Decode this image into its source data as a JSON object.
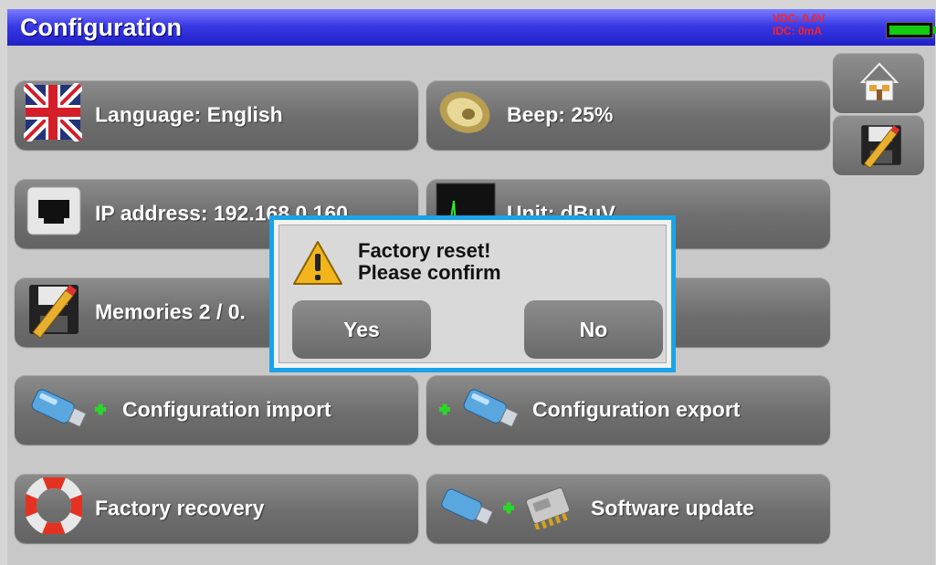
{
  "window": {
    "title": "Configuration"
  },
  "status": {
    "vdc": "VDC: 0.0V",
    "idc": "IDC: 0mA"
  },
  "menu": {
    "language": "Language: English",
    "beep": "Beep: 25%",
    "ip_address": "IP address: 192.168.0.160",
    "unit": "Unit: dBuV",
    "memories": "Memories 2 /  0.",
    "config_import": "Configuration import",
    "config_export": "Configuration export",
    "factory_recovery": "Factory recovery",
    "software_update": "Software update"
  },
  "sidebar": {
    "home_icon": "home-icon",
    "save_icon": "save-edit-icon"
  },
  "dialog": {
    "line1": "Factory reset!",
    "line2": "Please confirm",
    "yes_label": "Yes",
    "no_label": "No",
    "icon": "warning-icon",
    "border_color": "#1aa3e8"
  },
  "colors": {
    "titlebar": "#3a3ae6",
    "button": "#6e6e6e",
    "status_text": "#ff2020"
  }
}
